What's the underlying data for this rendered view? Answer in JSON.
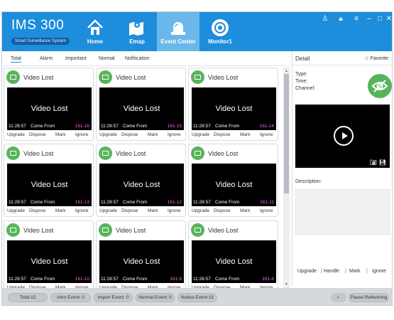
{
  "header": {
    "logo": "IMS 300",
    "logo_sub": "Smart Surveillance System",
    "nav": [
      {
        "label": "Home",
        "icon": "home-icon"
      },
      {
        "label": "Emap",
        "icon": "map-icon"
      },
      {
        "label": "Event Center",
        "icon": "alarm-bell-icon",
        "active": true
      },
      {
        "label": "Monitor1",
        "icon": "monitor-icon"
      }
    ],
    "window_controls": [
      "user-icon",
      "lock-icon",
      "menu-icon",
      "minimize-icon",
      "maximize-icon",
      "close-icon"
    ]
  },
  "filter_tabs": [
    "Total",
    "Alarm",
    "Important",
    "Normal",
    "Nofitication"
  ],
  "event_cards": [
    {
      "title": "Video Lost",
      "overlay": "Video Lost",
      "time": "11:28:57",
      "source_label": "Come From",
      "channel": "161-16"
    },
    {
      "title": "Video Lost",
      "overlay": "Video Lost",
      "time": "11:28:57",
      "source_label": "Come From",
      "channel": "161-15"
    },
    {
      "title": "Video Lost",
      "overlay": "Video Lost",
      "time": "11:28:57",
      "source_label": "Come From",
      "channel": "161-14"
    },
    {
      "title": "Video Lost",
      "overlay": "Video Lost",
      "time": "11:28:57",
      "source_label": "Come From",
      "channel": "161-13"
    },
    {
      "title": "Video Lost",
      "overlay": "Video Lost",
      "time": "11:28:57",
      "source_label": "Come From",
      "channel": "161-12"
    },
    {
      "title": "Video Lost",
      "overlay": "Video Lost",
      "time": "11:28:57",
      "source_label": "Come From",
      "channel": "161-11"
    },
    {
      "title": "Video Lost",
      "overlay": "Video Lost",
      "time": "11:28:57",
      "source_label": "Come From",
      "channel": "161-10"
    },
    {
      "title": "Video Lost",
      "overlay": "Video Lost",
      "time": "11:28:57",
      "source_label": "Come From",
      "channel": "161-9"
    },
    {
      "title": "Video Lost",
      "overlay": "Video Lost",
      "time": "11:28:57",
      "source_label": "Come From",
      "channel": "161-8"
    }
  ],
  "card_actions": [
    "Upgrade",
    "Dispose",
    "Mark",
    "Ignore"
  ],
  "detail": {
    "title": "Detail",
    "favorite": "☆ Favorite",
    "type_label": "Type:",
    "time_label": "Time:",
    "channel_label": "Channel:",
    "description_label": "Description:",
    "actions": [
      "Upgrade",
      "Handle",
      "Mark",
      "Ignore"
    ]
  },
  "footer": {
    "counts": [
      "Total:15",
      "Alrm Event: 0",
      "Import Event: 0",
      "Normal Event: 0",
      "Notice Event:15"
    ],
    "pause_label": "Pause Refreshing"
  },
  "colors": {
    "header": "#1d8ddc",
    "accent_green": "#58b45b",
    "channel_text": "#ea66ea"
  }
}
